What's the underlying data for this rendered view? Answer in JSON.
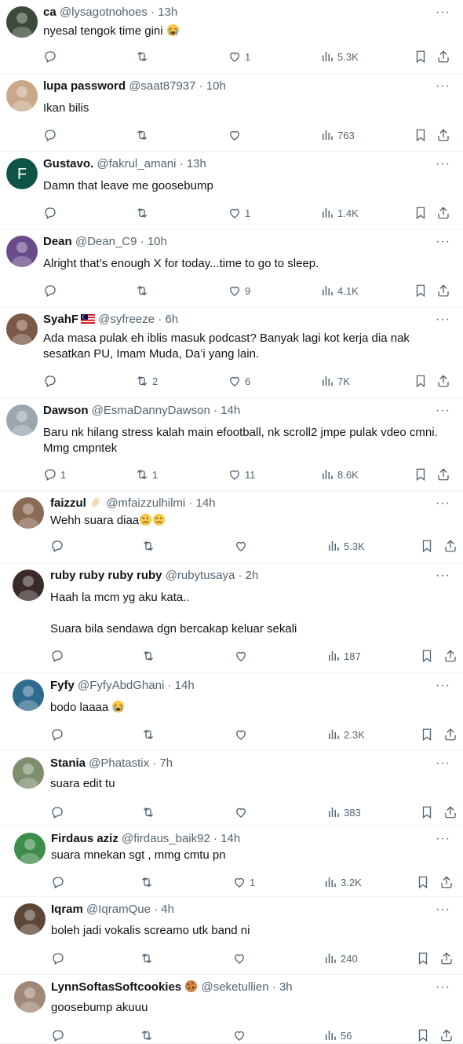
{
  "tweets": [
    {
      "name": "ca",
      "handle": "@lysagotnohoes",
      "time": "13h",
      "text": "nyesal tengok time gini",
      "emoji_after": "crying-face",
      "replies": "",
      "retweets": "",
      "likes": "1",
      "views": "5.3K",
      "avatar_color": "#3b4a3a"
    },
    {
      "name": "lupa password",
      "handle": "@saat87937",
      "time": "10h",
      "text": "Ikan bilis",
      "replies": "",
      "retweets": "",
      "likes": "",
      "views": "763",
      "avatar_color": "#c9a88a"
    },
    {
      "name": "Gustavo.",
      "handle": "@fakrul_amani",
      "time": "13h",
      "text": "Damn that leave me goosebump",
      "replies": "",
      "retweets": "",
      "likes": "1",
      "views": "1.4K",
      "avatar_color": "#0d5446",
      "avatar_letter": "F"
    },
    {
      "name": "Dean",
      "handle": "@Dean_C9",
      "time": "10h",
      "text": "Alright that’s enough X for today...time to go to sleep.",
      "replies": "",
      "retweets": "",
      "likes": "9",
      "views": "4.1K",
      "avatar_color": "#6a4c8a"
    },
    {
      "name": "SyahF",
      "handle": "@syfreeze",
      "time": "6h",
      "text": "Ada masa pulak eh iblis masuk podcast? Banyak lagi kot kerja dia nak sesatkan PU, Imam Muda, Da’i yang lain.",
      "replies": "",
      "retweets": "2",
      "likes": "6",
      "views": "7K",
      "avatar_color": "#7a5a45",
      "flag": "malaysia-flag"
    },
    {
      "name": "Dawson",
      "handle": "@EsmaDannyDawson",
      "time": "14h",
      "text": "Baru nk hilang stress kalah main efootball, nk scroll2 jmpe pulak vdeo cmni. Mmg cmpntek",
      "replies": "1",
      "retweets": "1",
      "likes": "11",
      "views": "8.6K",
      "avatar_color": "#9aa7ae"
    },
    {
      "name": "faizzul",
      "handle": "@mfaizzulhilmi",
      "time": "14h",
      "text": "Wehh suara diaa",
      "emoji_after": "sad-face-x2",
      "replies": "",
      "retweets": "",
      "likes": "",
      "views": "5.3K",
      "avatar_color": "#8a6a55",
      "name_emoji": "waving-hand"
    },
    {
      "name": "ruby ruby ruby ruby",
      "handle": "@rubytusaya",
      "time": "2h",
      "text": "Haah la mcm yg aku kata..\n\nSuara bila sendawa dgn bercakap keluar sekali",
      "replies": "",
      "retweets": "",
      "likes": "",
      "views": "187",
      "avatar_color": "#3a2b2a"
    },
    {
      "name": "Fyfy",
      "handle": "@FyfyAbdGhani",
      "time": "14h",
      "text": "bodo laaaa",
      "emoji_after": "crying-face",
      "replies": "",
      "retweets": "",
      "likes": "",
      "views": "2.3K",
      "avatar_color": "#2f6b8f"
    },
    {
      "name": "Stania",
      "handle": "@Phatastix",
      "time": "7h",
      "text": "suara edit tu",
      "replies": "",
      "retweets": "",
      "likes": "",
      "views": "383",
      "avatar_color": "#7e8f6e"
    },
    {
      "name": "Firdaus aziz",
      "handle": "@firdaus_baik92",
      "time": "14h",
      "text": "suara mnekan sgt , mmg cmtu pn",
      "replies": "",
      "retweets": "",
      "likes": "1",
      "views": "3.2K",
      "avatar_color": "#3f8d4a"
    },
    {
      "name": "Iqram",
      "handle": "@IqramQue",
      "time": "4h",
      "text": "boleh jadi vokalis screamo utk band ni",
      "replies": "",
      "retweets": "",
      "likes": "",
      "views": "240",
      "avatar_color": "#5b4638"
    },
    {
      "name": "LynnSoftasSoftcookies",
      "handle": "@seketullien",
      "time": "3h",
      "text": "goosebump akuuu",
      "replies": "",
      "retweets": "",
      "likes": "",
      "views": "56",
      "avatar_color": "#a08878",
      "name_emoji": "cookie"
    }
  ],
  "ui": {
    "dot": "·",
    "more": "···"
  },
  "colors": {
    "text": "#0f1419",
    "muted": "#536471",
    "divider": "#eff3f4"
  }
}
